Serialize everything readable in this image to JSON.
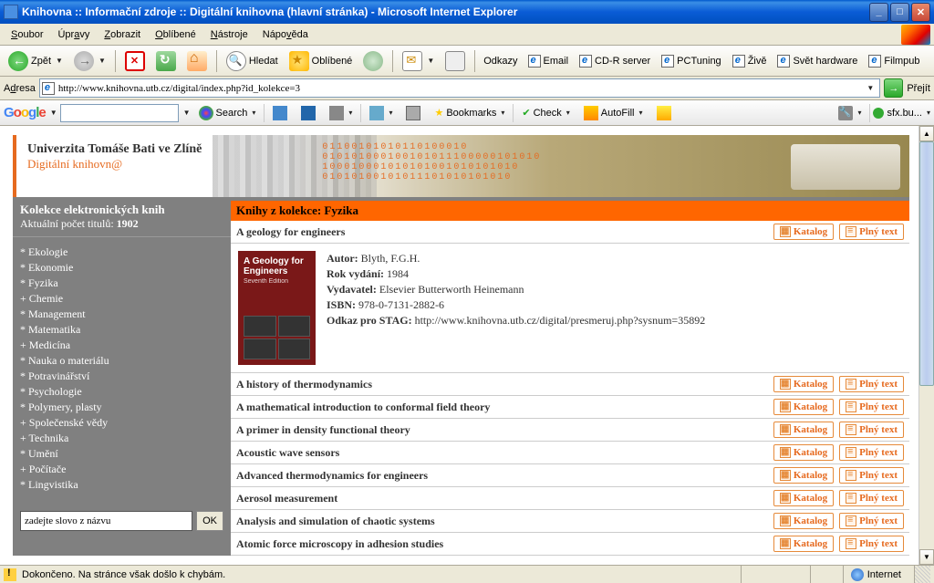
{
  "window": {
    "title": "Knihovna :: Informační zdroje :: Digitální knihovna (hlavní stránka) - Microsoft Internet Explorer"
  },
  "menu": {
    "file": "Soubor",
    "edit": "Úpravy",
    "view": "Zobrazit",
    "fav": "Oblíbené",
    "tools": "Nástroje",
    "help": "Nápověda"
  },
  "toolbar": {
    "back": "Zpět",
    "search": "Hledat",
    "favorites": "Oblíbené",
    "links_label": "Odkazy",
    "link_items": [
      "Email",
      "CD-R server",
      "PCTuning",
      "Živě",
      "Svět hardware",
      "Filmpub"
    ]
  },
  "address": {
    "label": "Adresa",
    "url": "http://www.knihovna.utb.cz/digital/index.php?id_kolekce=3",
    "go": "Přejít"
  },
  "gbar": {
    "search": "Search",
    "bookmarks": "Bookmarks",
    "check": "Check",
    "autofill": "AutoFill",
    "sfx": "sfx.bu..."
  },
  "page": {
    "uni": "Univerzita Tomáše Bati ve Zlíně",
    "lib": "Digitální knihovn@",
    "binary": "01100101010110100010\n010101000100101011100000101010\n100010001010101001010101010\n01010100101011101010101010"
  },
  "sidebar": {
    "title": "Kolekce elektronických knih",
    "count_label": "Aktuální počet titulů:",
    "count": "1902",
    "categories": [
      "* Ekologie",
      "* Ekonomie",
      "* Fyzika",
      "+ Chemie",
      "* Management",
      "* Matematika",
      "+ Medicína",
      "* Nauka o materiálu",
      "* Potravinářství",
      "* Psychologie",
      "* Polymery, plasty",
      "+ Společenské vědy",
      "+ Technika",
      "* Umění",
      "+ Počítače",
      "* Lingvistika"
    ],
    "search_placeholder": "zadejte slovo z názvu",
    "search_btn": "OK"
  },
  "main": {
    "coll_label": "Knihy z kolekce:",
    "coll_name": "Fyzika",
    "katalog": "Katalog",
    "plnytext": "Plný text",
    "expanded": {
      "title": "A geology for engineers",
      "cover_title": "A Geology for Engineers",
      "cover_sub": "Seventh Edition",
      "author_label": "Autor:",
      "author": "Blyth, F.G.H.",
      "year_label": "Rok vydání:",
      "year": "1984",
      "pub_label": "Vydavatel:",
      "pub": "Elsevier Butterworth Heinemann",
      "isbn_label": "ISBN:",
      "isbn": "978-0-7131-2882-6",
      "stag_label": "Odkaz pro STAG:",
      "stag": "http://www.knihovna.utb.cz/digital/presmeruj.php?sysnum=35892"
    },
    "books": [
      "A history of thermodynamics",
      "A mathematical introduction to conformal field theory",
      "A primer in density functional theory",
      "Acoustic wave sensors",
      "Advanced thermodynamics for engineers",
      "Aerosol measurement",
      "Analysis and simulation of chaotic systems",
      "Atomic force microscopy in adhesion studies"
    ]
  },
  "status": {
    "text": "Dokončeno. Na stránce však došlo k chybám.",
    "zone": "Internet"
  }
}
